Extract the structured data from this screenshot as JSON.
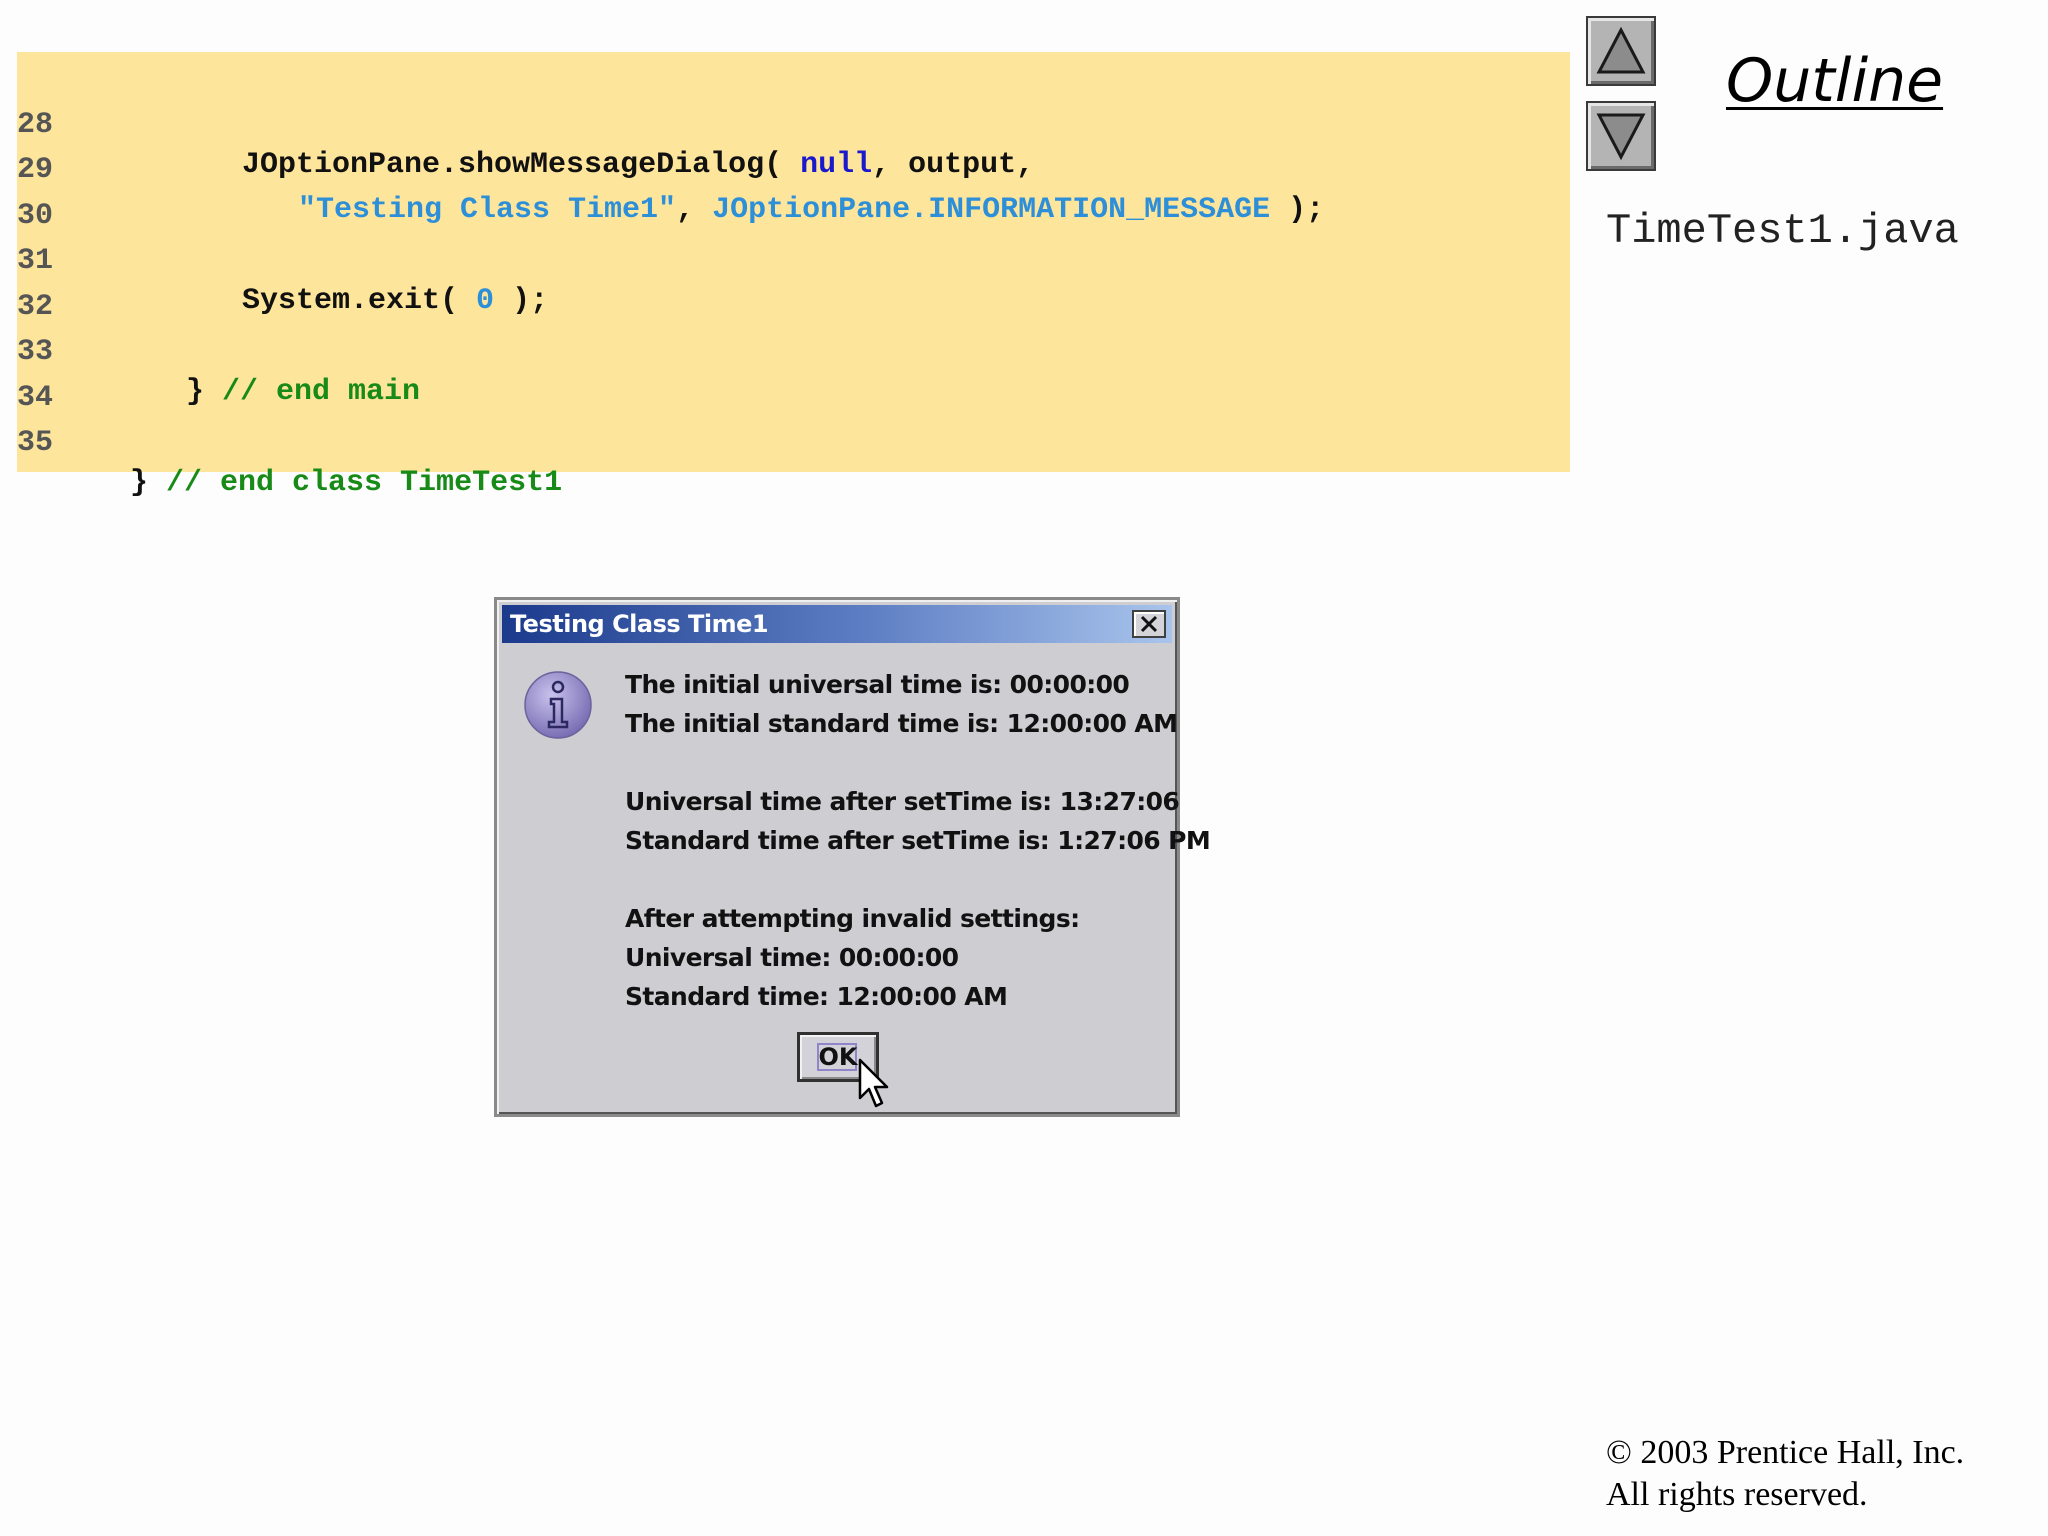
{
  "code": {
    "lines": [
      {
        "num": "28",
        "indent": "      ",
        "parts": [
          [
            "plain",
            "JOptionPane.showMessageDialog( "
          ],
          [
            "kw",
            "null"
          ],
          [
            "plain",
            ", output,"
          ]
        ]
      },
      {
        "num": "29",
        "indent": "         ",
        "parts": [
          [
            "str",
            "\"Testing Class Time1\""
          ],
          [
            "plain",
            ", "
          ],
          [
            "str",
            "JOptionPane.INFORMATION_MESSAGE"
          ],
          [
            "plain",
            " );"
          ]
        ]
      },
      {
        "num": "30",
        "indent": "",
        "parts": []
      },
      {
        "num": "31",
        "indent": "      ",
        "parts": [
          [
            "plain",
            "System.exit( "
          ],
          [
            "num",
            "0"
          ],
          [
            "plain",
            " );"
          ]
        ]
      },
      {
        "num": "32",
        "indent": "",
        "parts": []
      },
      {
        "num": "33",
        "indent": "   ",
        "parts": [
          [
            "plain",
            "} "
          ],
          [
            "cm",
            "// end main"
          ]
        ]
      },
      {
        "num": "34",
        "indent": "",
        "parts": []
      },
      {
        "num": "35",
        "indent": "",
        "parts": [
          [
            "plain",
            "} "
          ],
          [
            "cm",
            "// end class TimeTest1"
          ]
        ]
      }
    ]
  },
  "sidebar": {
    "title": "Outline",
    "file_name": "TimeTest1.java",
    "up_icon": "triangle-up-icon",
    "down_icon": "triangle-down-icon",
    "copyright_line1": "© 2003 Prentice Hall, Inc.",
    "copyright_line2": "All rights reserved."
  },
  "dialog": {
    "title": "Testing Class Time1",
    "icon": "information-icon",
    "close_icon": "close-icon",
    "lines": [
      "The initial universal time is: 00:00:00",
      "The initial standard time is: 12:00:00 AM",
      "",
      "Universal time after setTime is: 13:27:06",
      "Standard time after setTime is: 1:27:06 PM",
      "",
      "After attempting invalid settings:",
      "Universal time: 00:00:00",
      "Standard time: 12:00:00 AM"
    ],
    "ok_label": "OK"
  },
  "colors": {
    "code_background": "#fee59c",
    "keyword": "#1a1acc",
    "string": "#2d8fd8",
    "comment": "#178a17",
    "titlebar_start": "#1c3a8c",
    "titlebar_end": "#a9c4ec",
    "dialog_background": "#cdcdd2"
  }
}
